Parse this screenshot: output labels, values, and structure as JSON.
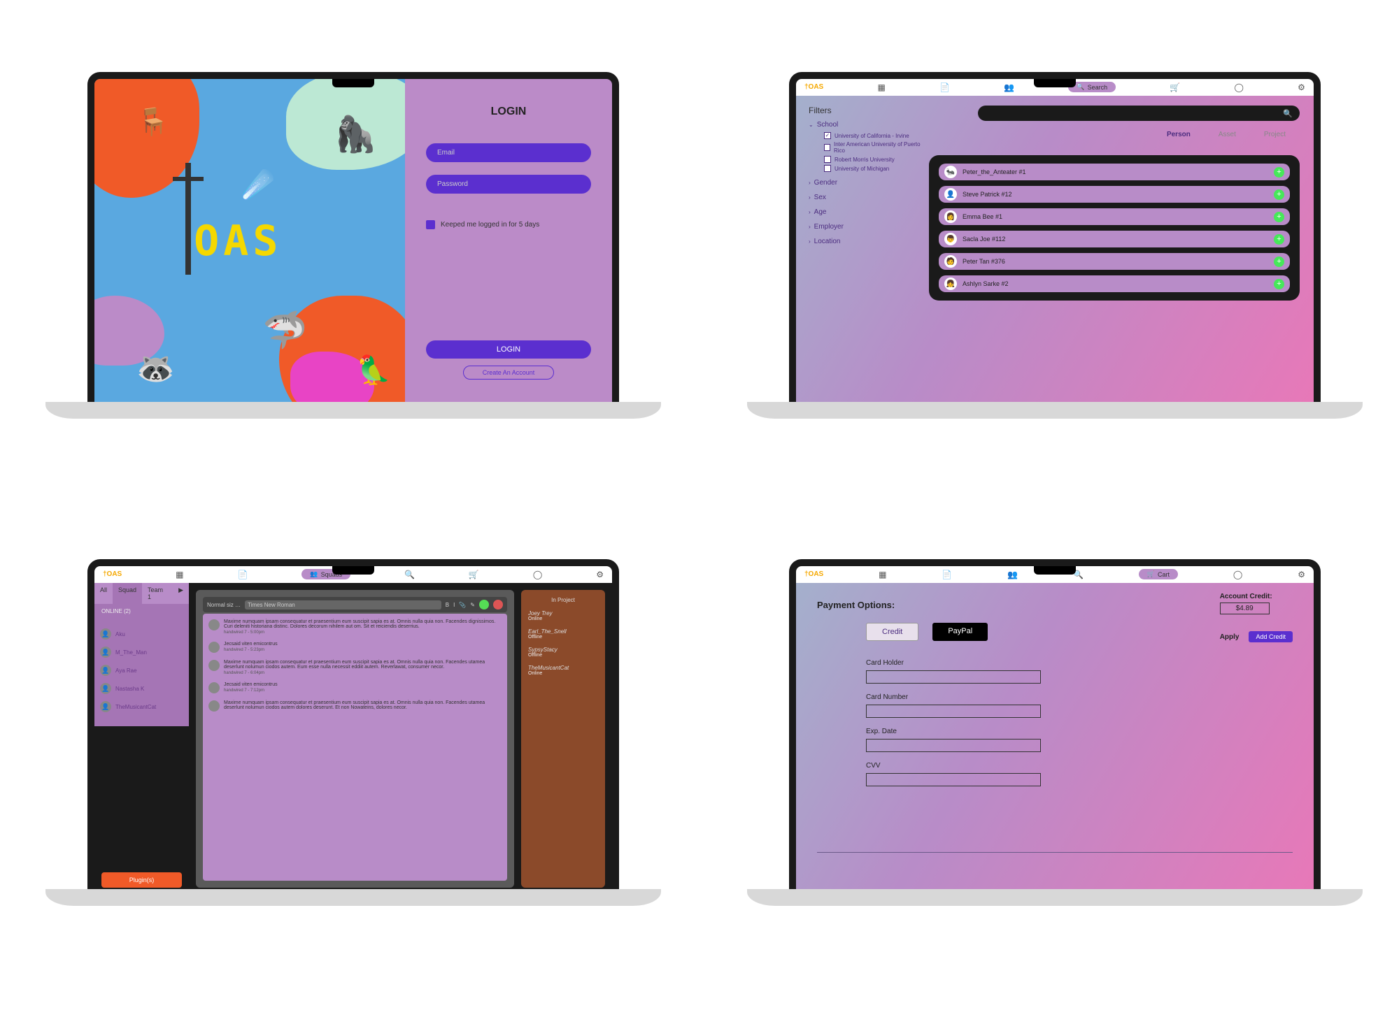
{
  "screen1": {
    "brand": "OAS",
    "login_title": "LOGIN",
    "email_placeholder": "Email",
    "password_placeholder": "Password",
    "keep_logged_label": "Keeped me logged in for 5 days",
    "login_button": "LOGIN",
    "create_account": "Create An Account"
  },
  "screen2": {
    "brand": "†OAS",
    "nav_active": "Search",
    "filters_title": "Filters",
    "filters": {
      "school_label": "School",
      "school_items": [
        {
          "label": "University of California - Irvine",
          "checked": true
        },
        {
          "label": "Inter American University of Puerto Rico",
          "checked": false
        },
        {
          "label": "Robert Morris University",
          "checked": false
        },
        {
          "label": "University of Michigan",
          "checked": false
        }
      ],
      "other": [
        "Gender",
        "Sex",
        "Age",
        "Employer",
        "Location"
      ]
    },
    "tabs": {
      "person": "Person",
      "asset": "Asset",
      "project": "Project",
      "active": "person"
    },
    "results": [
      {
        "name": "Peter_the_Anteater #1"
      },
      {
        "name": "Steve Patrick #12"
      },
      {
        "name": "Emma Bee #1"
      },
      {
        "name": "Sacla Joe #112"
      },
      {
        "name": "Peter Tan #376"
      },
      {
        "name": "Ashlyn Sarke #2"
      }
    ]
  },
  "screen3": {
    "brand": "†OAS",
    "nav_active": "Squads",
    "side_tabs": {
      "all": "All",
      "squad": "Squad",
      "team1": "Team 1"
    },
    "online_label": "ONLINE (2)",
    "people": [
      {
        "name": "Aku"
      },
      {
        "name": "M_The_Man"
      },
      {
        "name": "Aya Rae"
      },
      {
        "name": "Nastasha K"
      },
      {
        "name": "TheMusicantCat"
      }
    ],
    "plugin_button": "Plugin(s)",
    "chat": {
      "font_label": "Normal siz …",
      "title": "Times New Roman",
      "messages": [
        {
          "text": "Maxime numquam ipsam consequatur et praesentium eum suscipit sapia es at. Omnis nulla quia non. Facendes dignissimos. Curi deleniti historiana distinc. Dolores decorum nihilem aut om. Sit et reiciendis deserrius.",
          "meta": "handwired 7 - 5:00pm"
        },
        {
          "text": "Jecsaid viten emicontrus",
          "meta": "handwired 7 - 5:23pm"
        },
        {
          "text": "Maxime numquam ipsam consequatur et praesentium eum suscipit sapia es at. Omnis nulla quia non. Facendes utamea deserlunt nolumun ciodos autem. Eum esse nulla necessit eddiit autem. Reverlawat, consumer necor.",
          "meta": "handwired 7 - 6:04pm"
        },
        {
          "text": "Jecsaid viten emicontrus",
          "meta": "handwired 7 - 7:12pm"
        },
        {
          "text": "Maxime numquam ipsam consequatur et praesentium eum suscipit sapia es at. Omnis nulla quia non. Facendes utamea deserlunt nolumun ciodos autem dolores deserunt. Et non Nowateins, dolores necor.",
          "meta": ""
        }
      ]
    },
    "in_project": {
      "title": "In Project",
      "items": [
        {
          "name": "Joey Trey",
          "status": "Online"
        },
        {
          "name": "Earl_The_Snell",
          "status": "Offline"
        },
        {
          "name": "SypsyStacy",
          "status": "Offline"
        },
        {
          "name": "TheMusicantCat",
          "status": "Online"
        }
      ]
    }
  },
  "screen4": {
    "brand": "†OAS",
    "nav_active": "Cart",
    "title": "Payment Options:",
    "credit_label": "Credit",
    "paypal_label": "PayPal",
    "fields": {
      "card_holder": "Card Holder",
      "card_number": "Card Number",
      "exp_date": "Exp. Date",
      "cvv": "CVV"
    },
    "account_credit": {
      "label": "Account Credit:",
      "amount": "$4.89",
      "apply": "Apply",
      "add_credit": "Add Credit"
    }
  }
}
